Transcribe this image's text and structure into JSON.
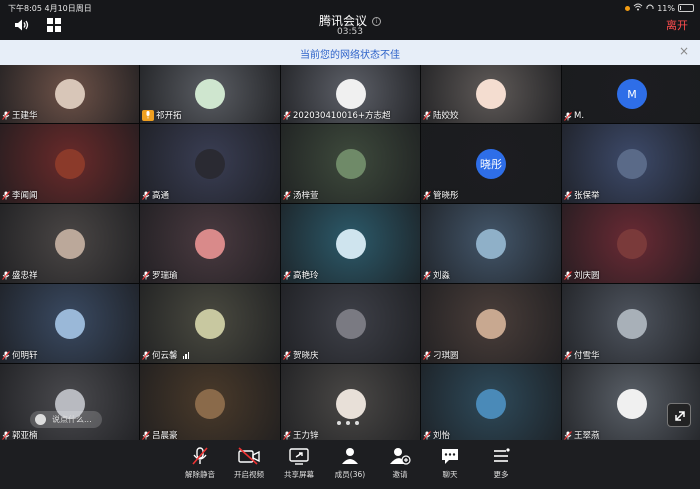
{
  "status": {
    "time_date": "下午8:05  4月10日周日",
    "battery": "11%",
    "battery_fill": 0.11
  },
  "header": {
    "title": "腾讯会议",
    "timer": "03:53",
    "leave_label": "离开"
  },
  "banner": {
    "message": "当前您的网络状态不佳",
    "close": "×"
  },
  "participants": [
    {
      "name": "王建华",
      "bg": "#6e5248",
      "avatar": "#d8c6b8"
    },
    {
      "name": "祁开拓",
      "bg": "#5a5d63",
      "avatar": "#cfe6cf",
      "speaking": true
    },
    {
      "name": "202030410016+方志超",
      "bg": "#5d6068",
      "avatar": "#f0f0f0"
    },
    {
      "name": "陆姣姣",
      "bg": "#5f5a58",
      "avatar": "#f4ddd0"
    },
    {
      "name": "M.",
      "bg": "#1c1d20",
      "avatar": "#2e6ee8",
      "initial": "M"
    },
    {
      "name": "李闻闻",
      "bg": "#6a2a2a",
      "avatar": "#8b3a2a"
    },
    {
      "name": "高通",
      "bg": "#3a3e54",
      "avatar": "#2a2a32"
    },
    {
      "name": "汤梓萱",
      "bg": "#3e4a3c",
      "avatar": "#6f8a68"
    },
    {
      "name": "管晓彤",
      "bg": "#1c1d20",
      "avatar": "#2e6ee8",
      "initial": "晓彤"
    },
    {
      "name": "张保举",
      "bg": "#3d4a6a",
      "avatar": "#5a6a88"
    },
    {
      "name": "盛忠祥",
      "bg": "#4a4645",
      "avatar": "#bba89a"
    },
    {
      "name": "罗瑞瑜",
      "bg": "#4a3a40",
      "avatar": "#d98a8a"
    },
    {
      "name": "高艳玲",
      "bg": "#2c5a6a",
      "avatar": "#cfe4ee"
    },
    {
      "name": "刘淼",
      "bg": "#43566a",
      "avatar": "#8fb0c8"
    },
    {
      "name": "刘庆圆",
      "bg": "#6a2a34",
      "avatar": "#7a3a3a"
    },
    {
      "name": "何明轩",
      "bg": "#3a4a62",
      "avatar": "#9ab8d8"
    },
    {
      "name": "何云馨",
      "bg": "#4a4a40",
      "avatar": "#c8c8a0",
      "signal": true
    },
    {
      "name": "贺晓庆",
      "bg": "#3e4048",
      "avatar": "#7a7a82"
    },
    {
      "name": "刁琪圆",
      "bg": "#4a3e3a",
      "avatar": "#c8a890"
    },
    {
      "name": "付雪华",
      "bg": "#4e545e",
      "avatar": "#a8b0b8"
    },
    {
      "name": "郭亚楠",
      "bg": "#4a4a4e",
      "avatar": "#b8bac0"
    },
    {
      "name": "吕晨豪",
      "bg": "#4a3a2a",
      "avatar": "#8a6a4a"
    },
    {
      "name": "王力锌",
      "bg": "#4a4846",
      "avatar": "#e8e0d8"
    },
    {
      "name": "刘怡",
      "bg": "#2e4a5a",
      "avatar": "#4a8ab8"
    },
    {
      "name": "王翠燕",
      "bg": "#5a6068",
      "avatar": "#f0f0f0"
    }
  ],
  "chat": {
    "placeholder": "说点什么..."
  },
  "toolbar": [
    {
      "label": "解除静音",
      "icon": "mic-muted-icon"
    },
    {
      "label": "开启视频",
      "icon": "camera-off-icon"
    },
    {
      "label": "共享屏幕",
      "icon": "share-screen-icon"
    },
    {
      "label": "成员(36)",
      "icon": "members-icon"
    },
    {
      "label": "邀请",
      "icon": "invite-icon"
    },
    {
      "label": "聊天",
      "icon": "chat-icon"
    },
    {
      "label": "更多",
      "icon": "more-icon"
    }
  ]
}
